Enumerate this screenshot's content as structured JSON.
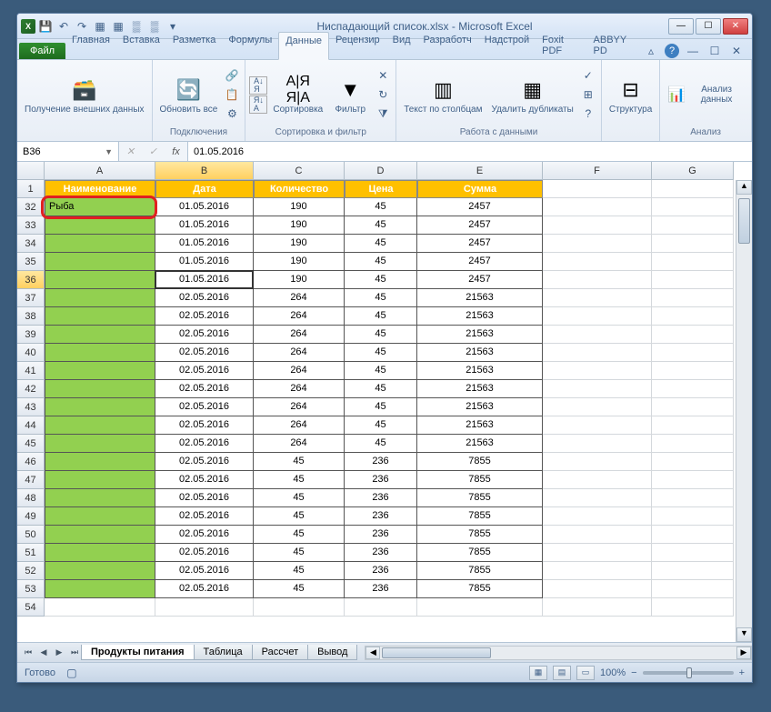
{
  "window": {
    "title": "Ниспадающий список.xlsx - Microsoft Excel"
  },
  "tabs": {
    "file": "Файл",
    "items": [
      "Главная",
      "Вставка",
      "Разметка",
      "Формулы",
      "Данные",
      "Рецензир",
      "Вид",
      "Разработч",
      "Надстрой",
      "Foxit PDF",
      "ABBYY PD"
    ],
    "active_index": 4
  },
  "ribbon": {
    "g0": {
      "btn": "Получение\nвнешних данных"
    },
    "g1": {
      "btn": "Обновить\nвсе",
      "label": "Подключения"
    },
    "g2": {
      "sort": "Сортировка",
      "filter": "Фильтр",
      "label": "Сортировка и фильтр"
    },
    "g3": {
      "text": "Текст по\nстолбцам",
      "dup": "Удалить\nдубликаты",
      "label": "Работа с данными"
    },
    "g4": {
      "btn": "Структура"
    },
    "g5": {
      "btn": "Анализ данных",
      "label": "Анализ"
    }
  },
  "namebox": "B36",
  "formula": "01.05.2016",
  "columns": [
    "A",
    "B",
    "C",
    "D",
    "E",
    "F",
    "G"
  ],
  "row_numbers": [
    "1",
    "32",
    "33",
    "34",
    "35",
    "36",
    "37",
    "38",
    "39",
    "40",
    "41",
    "42",
    "43",
    "44",
    "45",
    "46",
    "47",
    "48",
    "49",
    "50",
    "51",
    "52",
    "53",
    "54"
  ],
  "header_row": [
    "Наименование",
    "Дата",
    "Количество",
    "Цена",
    "Сумма"
  ],
  "data_rows": [
    [
      "Рыба",
      "01.05.2016",
      "190",
      "45",
      "2457"
    ],
    [
      "",
      "01.05.2016",
      "190",
      "45",
      "2457"
    ],
    [
      "",
      "01.05.2016",
      "190",
      "45",
      "2457"
    ],
    [
      "",
      "01.05.2016",
      "190",
      "45",
      "2457"
    ],
    [
      "",
      "01.05.2016",
      "190",
      "45",
      "2457"
    ],
    [
      "",
      "02.05.2016",
      "264",
      "45",
      "21563"
    ],
    [
      "",
      "02.05.2016",
      "264",
      "45",
      "21563"
    ],
    [
      "",
      "02.05.2016",
      "264",
      "45",
      "21563"
    ],
    [
      "",
      "02.05.2016",
      "264",
      "45",
      "21563"
    ],
    [
      "",
      "02.05.2016",
      "264",
      "45",
      "21563"
    ],
    [
      "",
      "02.05.2016",
      "264",
      "45",
      "21563"
    ],
    [
      "",
      "02.05.2016",
      "264",
      "45",
      "21563"
    ],
    [
      "",
      "02.05.2016",
      "264",
      "45",
      "21563"
    ],
    [
      "",
      "02.05.2016",
      "264",
      "45",
      "21563"
    ],
    [
      "",
      "02.05.2016",
      "45",
      "236",
      "7855"
    ],
    [
      "",
      "02.05.2016",
      "45",
      "236",
      "7855"
    ],
    [
      "",
      "02.05.2016",
      "45",
      "236",
      "7855"
    ],
    [
      "",
      "02.05.2016",
      "45",
      "236",
      "7855"
    ],
    [
      "",
      "02.05.2016",
      "45",
      "236",
      "7855"
    ],
    [
      "",
      "02.05.2016",
      "45",
      "236",
      "7855"
    ],
    [
      "",
      "02.05.2016",
      "45",
      "236",
      "7855"
    ],
    [
      "",
      "02.05.2016",
      "45",
      "236",
      "7855"
    ]
  ],
  "sheet_tabs": [
    "Продукты питания",
    "Таблица",
    "Рассчет",
    "Вывод"
  ],
  "active_sheet": 0,
  "status": "Готово",
  "zoom": "100%"
}
